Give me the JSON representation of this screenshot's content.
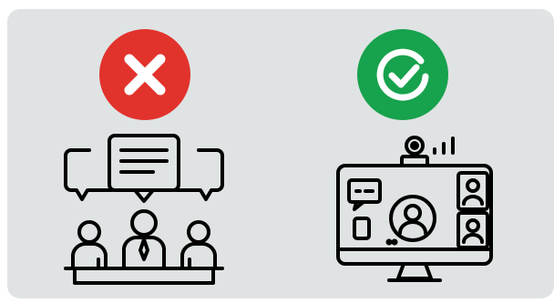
{
  "colors": {
    "panel_bg": "#dfe3e3",
    "reject_red": "#e2322c",
    "approve_green": "#17a24d",
    "line_art": "#000000"
  },
  "left": {
    "status_icon": "x-mark-icon",
    "illustration": "in-person-meeting-icon"
  },
  "right": {
    "status_icon": "check-circle-icon",
    "illustration": "video-conference-icon"
  }
}
